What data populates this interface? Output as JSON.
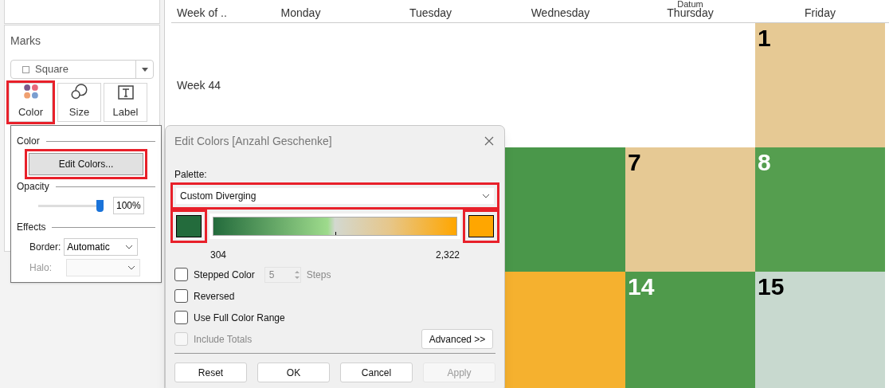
{
  "sidebar": {
    "marks_title": "Marks",
    "mark_type": "Square",
    "mark_buttons": [
      {
        "kind": "color",
        "label": "Color",
        "highlighted": true
      },
      {
        "kind": "size",
        "label": "Size",
        "highlighted": false
      },
      {
        "kind": "label",
        "label": "Label",
        "highlighted": false
      }
    ],
    "color_popover": {
      "color_heading": "Color",
      "edit_button": {
        "label": "Edit Colors...",
        "highlighted": true
      },
      "opacity_heading": "Opacity",
      "opacity": {
        "level": 1,
        "reading": "100%"
      },
      "effects_heading": "Effects",
      "border": {
        "label": "Border:",
        "value": "Automatic",
        "disabled": false
      },
      "halo": {
        "label": "Halo:",
        "disabled": true
      }
    }
  },
  "calendar": {
    "column_group": "Datum",
    "columns": [
      "Week of ..",
      "Monday",
      "Tuesday",
      "Wednesday",
      "Thursday",
      "Friday"
    ],
    "rows": [
      {
        "week": "Week 44",
        "cells": [
          null,
          null,
          null,
          null,
          {
            "day": "1",
            "color": "#e6c994"
          }
        ]
      },
      {
        "cells": [
          null,
          null,
          {
            "color": "#4a974a"
          },
          {
            "day": "7",
            "color": "#e6c994"
          },
          {
            "day": "8",
            "color": "#559e4f"
          }
        ]
      },
      {
        "cells": [
          null,
          null,
          {
            "color": "#f5b12f"
          },
          {
            "day": "14",
            "color": "#4f9a4b"
          },
          {
            "day": "15",
            "color": "#c8d9cf"
          }
        ]
      }
    ]
  },
  "dialog": {
    "title": "Edit Colors [Anzahl Geschenke]",
    "palette_label": "Palette:",
    "palette": {
      "value": "Custom Diverging",
      "highlighted": true
    },
    "start": {
      "color": "#236b3c",
      "highlighted": true
    },
    "end": {
      "color": "#ffa600",
      "highlighted": true
    },
    "min": "304",
    "max": "2,322",
    "options": [
      {
        "kind": "stepper",
        "label": "Stepped Color",
        "checked": false,
        "disabled": false,
        "steps": "5",
        "steps_label": "Steps"
      },
      {
        "kind": "plain",
        "label": "Reversed",
        "checked": false,
        "disabled": false
      },
      {
        "kind": "plain",
        "label": "Use Full Color Range",
        "checked": false,
        "disabled": false
      },
      {
        "kind": "plain",
        "label": "Include Totals",
        "checked": false,
        "disabled": true
      }
    ],
    "advanced": "Advanced >>",
    "buttons": [
      {
        "label": "Reset",
        "disabled": false
      },
      {
        "label": "OK",
        "disabled": false
      },
      {
        "label": "Cancel",
        "disabled": false
      },
      {
        "label": "Apply",
        "disabled": true
      }
    ]
  }
}
